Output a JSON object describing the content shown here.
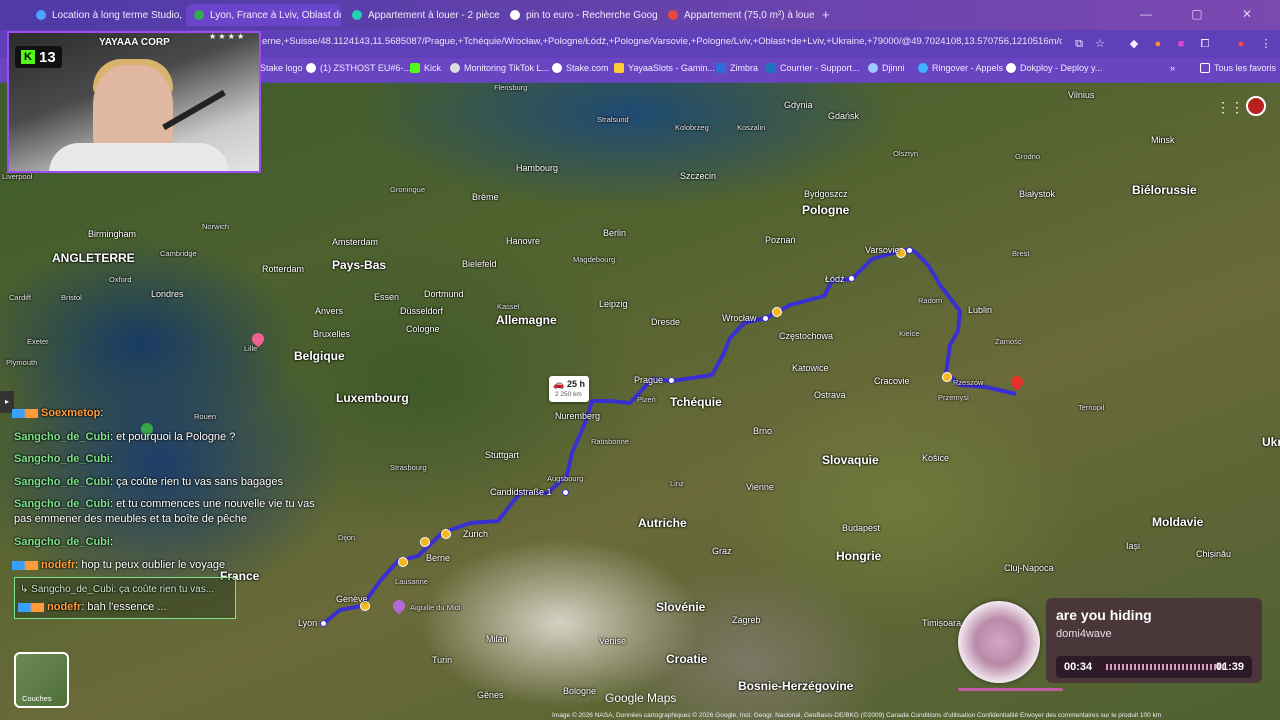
{
  "tabs": [
    {
      "label": "Location à long terme Studio, 3",
      "color": "#4aa4ff"
    },
    {
      "label": "Lyon, France à Lviv, Oblast de L",
      "color": "#34a853"
    },
    {
      "label": "Appartement à louer - 2 pièces",
      "color": "#1fd1b0"
    },
    {
      "label": "pin to euro - Recherche Google",
      "color": "#ffffff"
    },
    {
      "label": "Appartement (75,0 m²) à louer",
      "color": "#e8453c"
    }
  ],
  "new_tab": "+",
  "address": {
    "url": "erne,+Suisse/48.1124143,11.5685087/Prague,+Tchéquie/Wrocław,+Pologne/Łódź,+Pologne/Varsovie,+Pologne/Lviv,+Oblast+de+Lviv,+Ukraine,+79000/@49.7024108,13.570756,1210516m/data..."
  },
  "bookmarks": [
    {
      "label": "Stake logo",
      "color": "#ffffff"
    },
    {
      "label": "(1) ZSTHOST EU#6-...",
      "color": "#ffffff"
    },
    {
      "label": "Kick",
      "color": "#53fc18"
    },
    {
      "label": "Monitoring TikTok L...",
      "color": "#dddddd"
    },
    {
      "label": "Stake.com",
      "color": "#ffffff"
    },
    {
      "label": "YayaaSlots - Gamin...",
      "color": "#ffcc33"
    },
    {
      "label": "Zimbra",
      "color": "#2b6ed8"
    },
    {
      "label": "Courrier - Support...",
      "color": "#1e73be"
    },
    {
      "label": "Djinni",
      "color": "#9ecbff"
    },
    {
      "label": "Ringover - Appels",
      "color": "#3fb3ff"
    },
    {
      "label": "Dokploy - Deploy y...",
      "color": "#ffffff"
    }
  ],
  "bookmarks_more": "»",
  "all_bookmarks": "Tous les favoris",
  "webcam": {
    "label": "YAYAAA CORP",
    "viewers": "13",
    "stars": "★ ★ ★ ★"
  },
  "map": {
    "distance": {
      "time": "25 h",
      "km": "2 250 km"
    },
    "google": "Google Maps",
    "attribution": "Image © 2026 NASA, Données cartographiques © 2026 Google, Inst. Geogr. Nacional, GeoBasis-DE/BKG (©2009)   Canada   Conditions d'utilisation   Confidentialité   Envoyer des commentaires sur le produit   100 km",
    "layers": "Couches",
    "countries": [
      {
        "t": "Pologne"
      },
      {
        "t": "Allemagne"
      },
      {
        "t": "Tchéquie"
      },
      {
        "t": "Pays-Bas"
      },
      {
        "t": "Belgique"
      },
      {
        "t": "Luxembourg"
      },
      {
        "t": "Slovaquie"
      },
      {
        "t": "Autriche"
      },
      {
        "t": "Hongrie"
      },
      {
        "t": "Slovénie"
      },
      {
        "t": "Croatie"
      },
      {
        "t": "Bosnie-Herzégovine"
      },
      {
        "t": "Moldavie"
      },
      {
        "t": "Biélorussie"
      },
      {
        "t": "France"
      },
      {
        "t": "ANGLETERRE"
      },
      {
        "t": "Ukr"
      }
    ],
    "cities": [
      {
        "t": "Flensburg"
      },
      {
        "t": "Gdynia"
      },
      {
        "t": "Gdańsk"
      },
      {
        "t": "Vilnius"
      },
      {
        "t": "Stralsund"
      },
      {
        "t": "Kolobrzeg"
      },
      {
        "t": "Koszalin"
      },
      {
        "t": "Hambourg"
      },
      {
        "t": "Szczecin"
      },
      {
        "t": "Bydgoszcz"
      },
      {
        "t": "Olsztyn"
      },
      {
        "t": "Białystok"
      },
      {
        "t": "Minsk"
      },
      {
        "t": "Brême"
      },
      {
        "t": "Groningue"
      },
      {
        "t": "Amsterdam"
      },
      {
        "t": "Hanovre"
      },
      {
        "t": "Berlin"
      },
      {
        "t": "Poznań"
      },
      {
        "t": "Varsovie"
      },
      {
        "t": "Łódź"
      },
      {
        "t": "Rotterdam"
      },
      {
        "t": "Bielefeld"
      },
      {
        "t": "Magdebourg"
      },
      {
        "t": "Wrocław"
      },
      {
        "t": "Lublin"
      },
      {
        "t": "Birmingham"
      },
      {
        "t": "Londres"
      },
      {
        "t": "Essen"
      },
      {
        "t": "Dortmund"
      },
      {
        "t": "Düsseldorf"
      },
      {
        "t": "Cologne"
      },
      {
        "t": "Leipzig"
      },
      {
        "t": "Dresde"
      },
      {
        "t": "Częstochowa"
      },
      {
        "t": "Anvers"
      },
      {
        "t": "Bruxelles"
      },
      {
        "t": "Prague"
      },
      {
        "t": "Katowice"
      },
      {
        "t": "Cracovie"
      },
      {
        "t": "Rzeszów"
      },
      {
        "t": "Przemyśl"
      },
      {
        "t": "Nuremberg"
      },
      {
        "t": "Plzeň"
      },
      {
        "t": "Ostrava"
      },
      {
        "t": "Ratisbonne"
      },
      {
        "t": "Brno"
      },
      {
        "t": "Košice"
      },
      {
        "t": "Stuttgart"
      },
      {
        "t": "Augsbourg"
      },
      {
        "t": "Vienne"
      },
      {
        "t": "Candidstraße 1"
      },
      {
        "t": "Linz"
      },
      {
        "t": "Zurich"
      },
      {
        "t": "Berne"
      },
      {
        "t": "Budapest"
      },
      {
        "t": "Graz"
      },
      {
        "t": "Genève"
      },
      {
        "t": "Lyon"
      },
      {
        "t": "Turin"
      },
      {
        "t": "Milan"
      },
      {
        "t": "Venise"
      },
      {
        "t": "Zagreb"
      },
      {
        "t": "Chișinău"
      },
      {
        "t": "Iași"
      },
      {
        "t": "Strasbourg"
      },
      {
        "t": "Dijon"
      },
      {
        "t": "Lausanne"
      },
      {
        "t": "Aiguille du Midi"
      },
      {
        "t": "Timișoara"
      },
      {
        "t": "Cluj-Napoca"
      },
      {
        "t": "Bologne"
      },
      {
        "t": "Gênes"
      },
      {
        "t": "Ternopil"
      },
      {
        "t": "Rouen"
      },
      {
        "t": "Cambridge"
      },
      {
        "t": "Norwich"
      },
      {
        "t": "Oxford"
      },
      {
        "t": "Bristol"
      },
      {
        "t": "Cardiff"
      },
      {
        "t": "Exeter"
      },
      {
        "t": "Plymouth"
      },
      {
        "t": "Liverpool"
      },
      {
        "t": "Lille"
      },
      {
        "t": "Kassel"
      },
      {
        "t": "Radom"
      },
      {
        "t": "Kielce"
      },
      {
        "t": "Zamość"
      },
      {
        "t": "Brest"
      },
      {
        "t": "Grodno"
      }
    ]
  },
  "chat": [
    {
      "user": "Soexmetop",
      "text": ":"
    },
    {
      "user": "Sangcho_de_Cubi",
      "text": ": et pourquoi la Pologne ?"
    },
    {
      "user": "Sangcho_de_Cubi",
      "text": ":"
    },
    {
      "user": "Sangcho_de_Cubi",
      "text": ": ça coûte rien tu vas sans bagages"
    },
    {
      "user": "Sangcho_de_Cubi",
      "text": ": et tu commences une nouvelle vie tu vas pas emmener des meubles et ta boîte de pêche"
    },
    {
      "user": "Sangcho_de_Cubi",
      "text": ":"
    },
    {
      "user": "nodefr",
      "text": ": hop tu peux oublier le voyage"
    },
    {
      "user": "Sangcho_de_Cubi",
      "text": ": ça coûte rien tu vas..."
    },
    {
      "user": "nodefr",
      "text": ": bah l'essence ..."
    }
  ],
  "music": {
    "title": "are you hiding",
    "artist": "domi4wave",
    "current": "00:34",
    "duration": "01:39",
    "progress": 0.35
  }
}
